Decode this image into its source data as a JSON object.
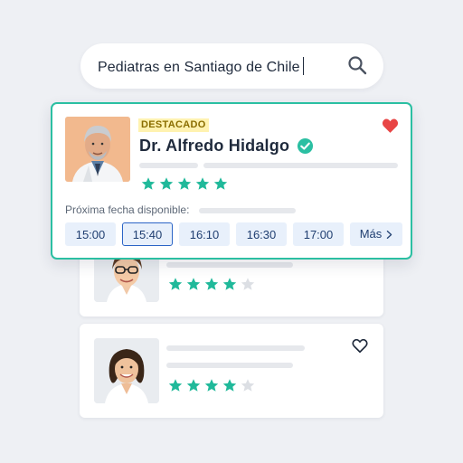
{
  "search": {
    "query": "Pediatras en Santiago de Chile",
    "icon": "search-icon"
  },
  "featured": {
    "badge": "DESTACADO",
    "doctor_name": "Dr. Alfredo Hidalgo",
    "rating": 5,
    "favorited": true,
    "next_date_label": "Próxima fecha disponible:",
    "slots": [
      "15:00",
      "15:40",
      "16:10",
      "16:30",
      "17:00"
    ],
    "selected_slot": "15:40",
    "more_label": "Más"
  },
  "cards": [
    {
      "rating": 4,
      "favorited": false
    },
    {
      "rating": 4,
      "favorited": false
    }
  ],
  "colors": {
    "accent": "#2bbfa2",
    "star": "#20b99a",
    "heart": "#e84545",
    "slot_bg": "#e8f0fb",
    "selected_border": "#2b64c6"
  }
}
